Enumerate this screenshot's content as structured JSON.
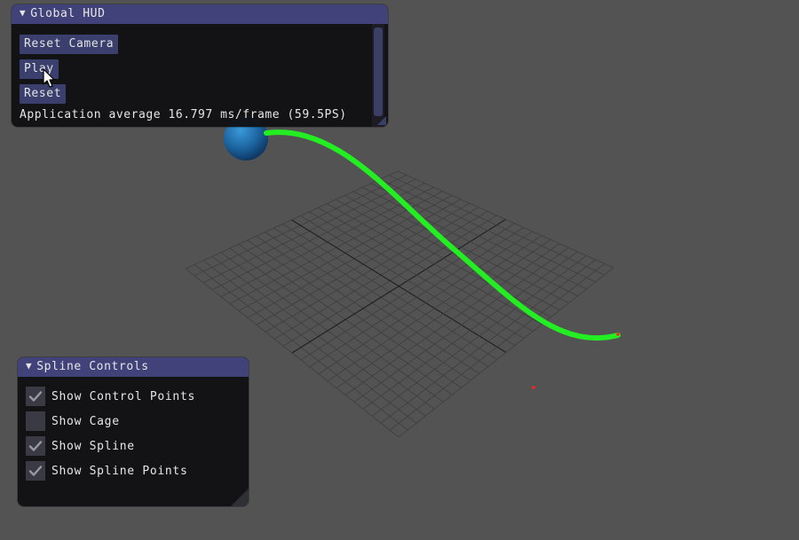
{
  "hud": {
    "title": "Global HUD",
    "reset_camera_label": "Reset Camera",
    "play_label": "Play",
    "reset_label": "Reset",
    "stats_text": "Application average 16.797 ms/frame (59.5PS)"
  },
  "spline_controls": {
    "title": "Spline Controls",
    "options": [
      {
        "label": "Show Control Points",
        "checked": true
      },
      {
        "label": "Show Cage",
        "checked": false
      },
      {
        "label": "Show Spline",
        "checked": true
      },
      {
        "label": "Show Spline Points",
        "checked": true
      }
    ]
  },
  "icons": {
    "collapse": "triangle-down-icon",
    "check": "checkmark-icon",
    "cursor": "mouse-pointer-icon"
  },
  "colors": {
    "background": "#535353",
    "title_bar": "#42427a",
    "button": "#3a3f6e",
    "spline": "#22ee22",
    "sphere": "#1f6fa8",
    "control_point": "#ff2020"
  }
}
